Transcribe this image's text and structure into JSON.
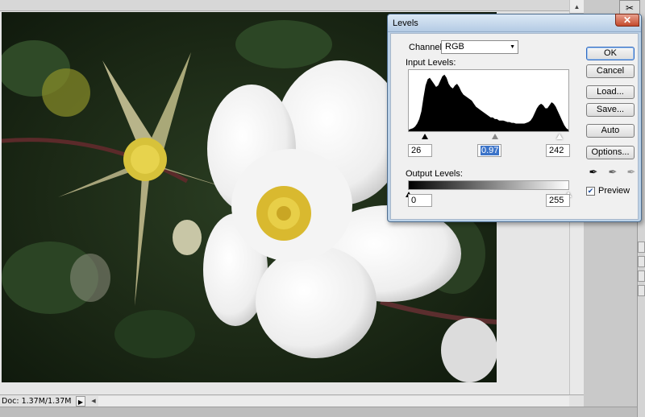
{
  "document": {
    "info": "Doc: 1.37M/1.37M",
    "info_menu_icon": "triangle-right-icon",
    "image_description_icon": "photo-image"
  },
  "levels": {
    "title": "Levels",
    "close_icon": "close-x-icon",
    "channel_label": "Channel:",
    "channel_value": "RGB",
    "input_levels_label": "Input Levels:",
    "input_black": "26",
    "input_gray": "0.97",
    "input_white": "242",
    "output_levels_label": "Output Levels:",
    "output_black": "0",
    "output_white": "255",
    "buttons": {
      "ok": "OK",
      "cancel": "Cancel",
      "load": "Load...",
      "save": "Save...",
      "auto": "Auto",
      "options": "Options..."
    },
    "preview_label": "Preview",
    "preview_checked": true,
    "histogram": [
      2,
      3,
      4,
      6,
      10,
      16,
      26,
      44,
      60,
      68,
      70,
      66,
      62,
      58,
      60,
      66,
      72,
      74,
      70,
      62,
      58,
      56,
      60,
      62,
      58,
      52,
      48,
      46,
      44,
      42,
      40,
      36,
      32,
      30,
      28,
      26,
      24,
      22,
      20,
      18,
      18,
      16,
      16,
      14,
      14,
      14,
      13,
      12,
      12,
      11,
      11,
      10,
      10,
      10,
      10,
      10,
      11,
      12,
      14,
      18,
      24,
      30,
      34,
      36,
      34,
      30,
      30,
      34,
      38,
      36,
      32,
      26,
      20,
      14,
      8,
      4,
      2
    ]
  },
  "colors": {
    "dialog_border": "#4d6d8f",
    "title_gradient_top": "#dbe8f5",
    "close_red": "#c44a2c",
    "selection_blue": "#3b73c8"
  }
}
